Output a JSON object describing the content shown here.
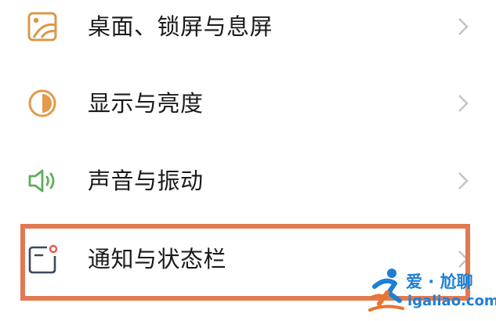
{
  "settings": {
    "items": [
      {
        "label": "桌面、锁屏与息屏",
        "icon": "wallpaper-icon",
        "color": "#d9984a"
      },
      {
        "label": "显示与亮度",
        "icon": "brightness-icon",
        "color": "#e39a4a"
      },
      {
        "label": "声音与振动",
        "icon": "speaker-icon",
        "color": "#5fae5a"
      },
      {
        "label": "通知与状态栏",
        "icon": "notification-icon",
        "color": "#3b4a5c"
      }
    ],
    "chevron_icon": "chevron-right-icon",
    "highlight_color": "#e07a52"
  },
  "watermark": {
    "title": "爱 · 尬聊",
    "url": "igaliao.com",
    "color": "#1d7fd6"
  }
}
